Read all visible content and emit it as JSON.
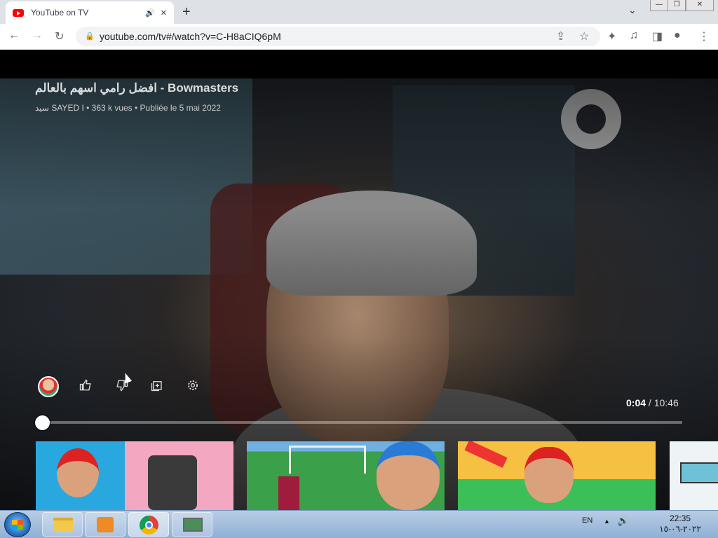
{
  "browser": {
    "tab_title": "YouTube on TV",
    "url": "youtube.com/tv#/watch?v=C-H8aCIQ6pM"
  },
  "video": {
    "title": "افضل رامي اسهم بالعالم - Bowmasters",
    "meta": "سيد SAYED I • 363 k vues • Publiée le 5 mai 2022",
    "current_time": "0:04",
    "separator": "/",
    "duration": "10:46",
    "progress_fraction": 0.006
  },
  "controls": {
    "icons": [
      "channel-avatar",
      "like-icon",
      "dislike-icon",
      "add-to-queue-icon",
      "settings-icon"
    ]
  },
  "suggestions": [
    {
      "name": "suggestion-1"
    },
    {
      "name": "suggestion-2"
    },
    {
      "name": "suggestion-3"
    },
    {
      "name": "suggestion-4"
    }
  ],
  "taskbar": {
    "language": "EN",
    "time": "22:35",
    "date": "٢٠٢٢-٠٦-١٥"
  }
}
